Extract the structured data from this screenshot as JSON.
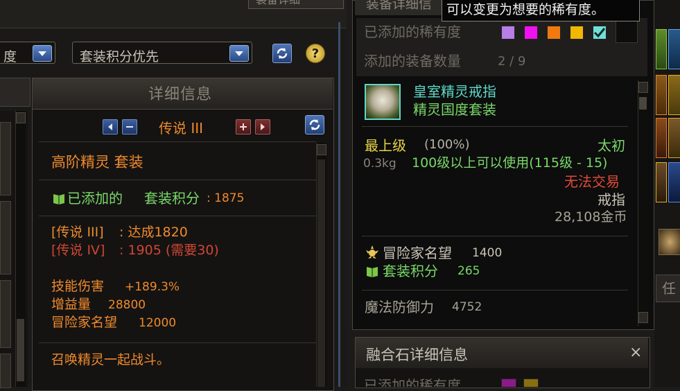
{
  "top_tab_label": "装备详细",
  "top_tab_label_cut": "装备详细信",
  "tooltip_text": "可以变更为想要的稀有度。",
  "left": {
    "dropdown1": "度",
    "dropdown2": "套装积分优先",
    "panel_title": "详细信息",
    "tier_label": "传说 III",
    "set_name": "高阶精灵  套装",
    "added_label": "已添加的",
    "set_points_label": "套装积分",
    "set_points_value": ": 1875",
    "tier_achieved_label": "[传说 III]",
    "tier_achieved_value": ": 达成1820",
    "tier_next_label": "[传说 IV]",
    "tier_next_value": ": 1905 (需要30)",
    "stats": [
      {
        "label": "技能伤害",
        "value": "+189.3%"
      },
      {
        "label": "增益量",
        "value": "28800"
      },
      {
        "label": "冒险家名望",
        "value": "12000"
      }
    ],
    "effect_text": "召唤精灵一起战斗。"
  },
  "right": {
    "rarity_label": "已添加的稀有度",
    "count_label": "添加的装备数量",
    "count_value": "2 / 9",
    "rarity_colors": [
      "#b77ee6",
      "#f011f0",
      "#f07a10",
      "#f0b800",
      "#6fe0d8"
    ],
    "item_name": "皇室精灵戒指",
    "item_set": "精灵国度套装",
    "grade_label": "最上级",
    "grade_pct": "(100%)",
    "grade_right": "太初",
    "weight": "0.3kg",
    "level_req": "100级以上可以使用(115级 - 15)",
    "trade": "无法交易",
    "slot": "戒指",
    "price": "28,108金币",
    "fame_label": "冒险家名望",
    "fame_value": "1400",
    "set_points_label": "套装积分",
    "set_points_value": "265",
    "mdef_label": "魔法防御力",
    "mdef_value": "4752"
  },
  "bottom": {
    "title": "融合石详细信息",
    "close": "×",
    "rarity_label_cut": "已添加的稀有度"
  },
  "far_right": {
    "tab_label": "任"
  },
  "colors": {
    "orange": "#f08a2c",
    "green": "#7ad86a",
    "gold": "#e8c65a",
    "red": "#e04a3a",
    "cyan": "#5ed8c8"
  }
}
